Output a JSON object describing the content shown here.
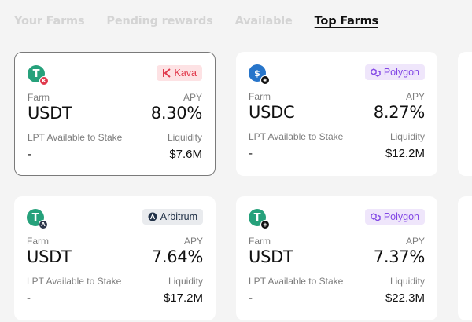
{
  "tabs": [
    {
      "label": "Your Farms",
      "active": false
    },
    {
      "label": "Pending rewards",
      "active": false
    },
    {
      "label": "Available",
      "active": false
    },
    {
      "label": "Top Farms",
      "active": true
    }
  ],
  "labels": {
    "farm": "Farm",
    "apy": "APY",
    "lpt": "LPT Available to Stake",
    "liquidity": "Liquidity"
  },
  "cards": [
    {
      "token": "USDT",
      "token_icon": "usdt-icon",
      "chain": "Kava",
      "chain_icon": "kava-icon",
      "apy": "8.30%",
      "lpt_available": "-",
      "liquidity": "$7.6M",
      "selected": true
    },
    {
      "token": "USDC",
      "token_icon": "usdc-icon",
      "chain": "Polygon",
      "chain_icon": "polygon-icon",
      "apy": "8.27%",
      "lpt_available": "-",
      "liquidity": "$12.2M",
      "selected": false
    },
    {
      "token": "USDT",
      "token_icon": "usdt-icon",
      "chain": "Arbitrum",
      "chain_icon": "arbitrum-icon",
      "apy": "7.64%",
      "lpt_available": "-",
      "liquidity": "$17.2M",
      "selected": false
    },
    {
      "token": "USDT",
      "token_icon": "usdt-icon",
      "chain": "Polygon",
      "chain_icon": "polygon-icon",
      "apy": "7.37%",
      "lpt_available": "-",
      "liquidity": "$22.3M",
      "selected": false
    }
  ],
  "colors": {
    "kava": "#e0384b",
    "polygon": "#8247e5",
    "arbitrum": "#213147",
    "usdt": "#26a17b",
    "usdc": "#2775ca"
  }
}
